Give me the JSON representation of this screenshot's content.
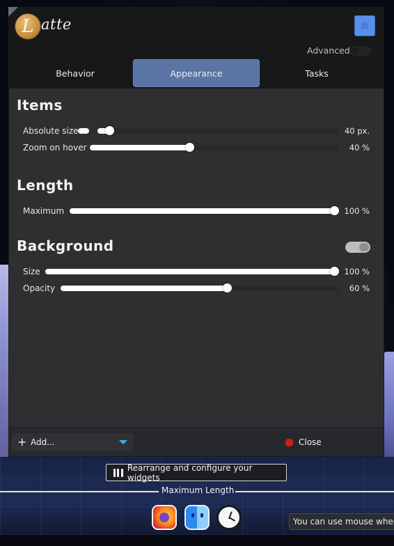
{
  "header": {
    "logo_letter": "L",
    "brand_rest": "atte",
    "advanced_label": "Advanced",
    "accent_color": "#5a8fe8"
  },
  "tabs": [
    {
      "label": "Behavior",
      "active": false
    },
    {
      "label": "Appearance",
      "active": true
    },
    {
      "label": "Tasks",
      "active": false
    }
  ],
  "items": {
    "title": "Items",
    "absolute_size": {
      "label": "Absolute size",
      "value": "40 px.",
      "fraction": 0.05
    },
    "zoom_on_hover": {
      "label": "Zoom on hover",
      "value": "40 %",
      "fraction": 0.4
    }
  },
  "length": {
    "title": "Length",
    "maximum": {
      "label": "Maximum",
      "value": "100 %",
      "fraction": 1.0
    }
  },
  "background": {
    "title": "Background",
    "enabled": true,
    "size": {
      "label": "Size",
      "value": "100 %",
      "fraction": 1.0
    },
    "opacity": {
      "label": "Opacity",
      "value": "60 %",
      "fraction": 0.6
    }
  },
  "footer": {
    "add_label": "Add...",
    "close_label": "Close",
    "close_color": "#c5221f"
  },
  "dock": {
    "rearrange_label": "Rearrange and configure your widgets",
    "max_length_label": "Maximum Length",
    "apps": [
      "firefox-icon",
      "finder-icon",
      "clock-icon"
    ],
    "tooltip": "You can use mouse wheel"
  }
}
